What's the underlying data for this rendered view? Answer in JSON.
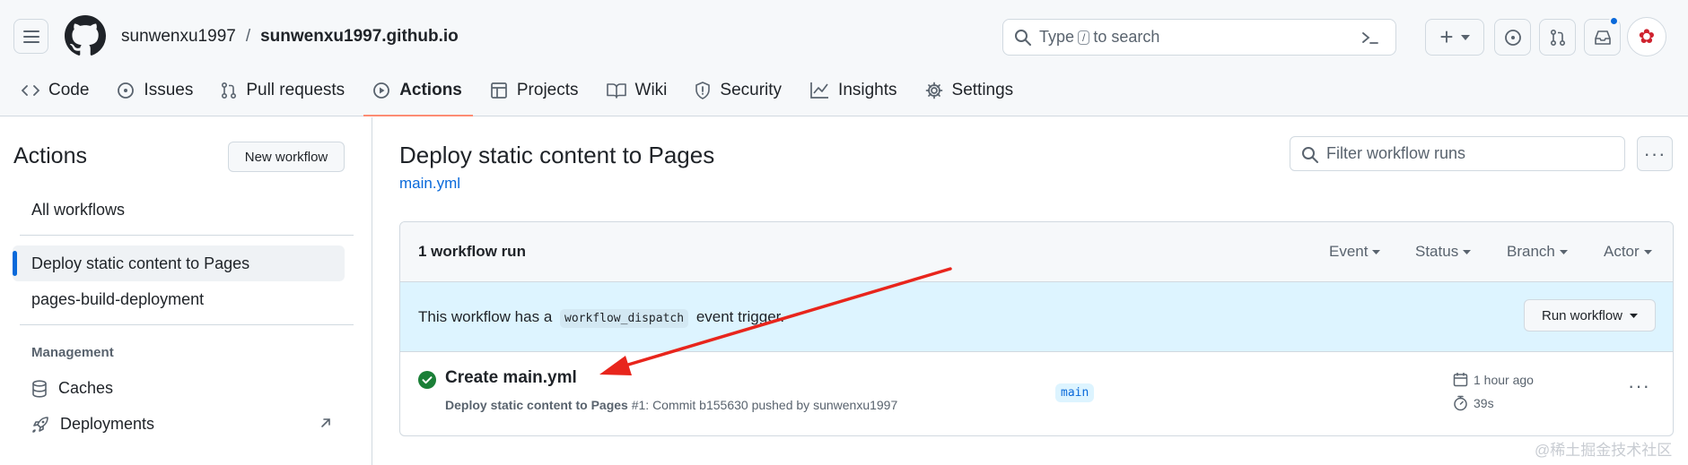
{
  "header": {
    "owner": "sunwenxu1997",
    "separator": "/",
    "repo": "sunwenxu1997.github.io",
    "search_prefix": "Type",
    "search_key": "/",
    "search_suffix": "to search",
    "plus_label": "+"
  },
  "tabs": [
    {
      "label": "Code",
      "icon": "code-icon"
    },
    {
      "label": "Issues",
      "icon": "issue-icon"
    },
    {
      "label": "Pull requests",
      "icon": "pull-request-icon"
    },
    {
      "label": "Actions",
      "icon": "play-icon",
      "active": true
    },
    {
      "label": "Projects",
      "icon": "table-icon"
    },
    {
      "label": "Wiki",
      "icon": "book-icon"
    },
    {
      "label": "Security",
      "icon": "shield-icon"
    },
    {
      "label": "Insights",
      "icon": "graph-icon"
    },
    {
      "label": "Settings",
      "icon": "gear-icon"
    }
  ],
  "sidebar": {
    "title": "Actions",
    "new_workflow": "New workflow",
    "all_workflows": "All workflows",
    "workflows": [
      "Deploy static content to Pages",
      "pages-build-deployment"
    ],
    "management_heading": "Management",
    "management_items": [
      "Caches",
      "Deployments"
    ]
  },
  "main": {
    "title": "Deploy static content to Pages",
    "file": "main.yml",
    "filter_placeholder": "Filter workflow runs",
    "runs_count": "1 workflow run",
    "filters": [
      "Event",
      "Status",
      "Branch",
      "Actor"
    ],
    "banner_prefix": "This workflow has a",
    "banner_code": "workflow_dispatch",
    "banner_suffix": "event trigger.",
    "run_workflow": "Run workflow",
    "run": {
      "title": "Create main.yml",
      "workflow": "Deploy static content to Pages",
      "meta": "#1: Commit b155630 pushed by sunwenxu1997",
      "branch": "main",
      "time_ago": "1 hour ago",
      "duration": "39s",
      "status": "success"
    }
  },
  "watermark": "@稀土掘金技术社区",
  "colors": {
    "accent": "#0969da",
    "success": "#1a7f37",
    "annotation": "#e8251c",
    "tab_underline": "#fd8c73"
  }
}
